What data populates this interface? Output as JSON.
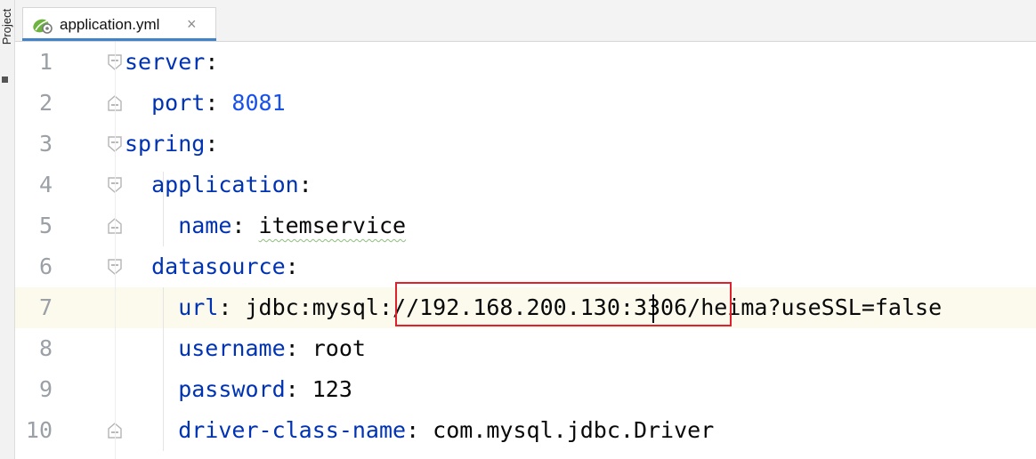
{
  "sidebar": {
    "label": "Project"
  },
  "tab": {
    "title": "application.yml",
    "close": "×"
  },
  "lines": [
    {
      "num": "1",
      "parts": [
        {
          "t": "server",
          "c": "key"
        },
        {
          "t": ":",
          "c": "val"
        }
      ]
    },
    {
      "num": "2",
      "parts": [
        {
          "t": "  port",
          "c": "key"
        },
        {
          "t": ": ",
          "c": "val"
        },
        {
          "t": "8081",
          "c": "num"
        }
      ]
    },
    {
      "num": "3",
      "parts": [
        {
          "t": "spring",
          "c": "key"
        },
        {
          "t": ":",
          "c": "val"
        }
      ]
    },
    {
      "num": "4",
      "parts": [
        {
          "t": "  application",
          "c": "key"
        },
        {
          "t": ":",
          "c": "val"
        }
      ]
    },
    {
      "num": "5",
      "parts": [
        {
          "t": "    name",
          "c": "key"
        },
        {
          "t": ": ",
          "c": "val"
        },
        {
          "t": "itemservice",
          "c": "val wavy"
        }
      ]
    },
    {
      "num": "6",
      "parts": [
        {
          "t": "  datasource",
          "c": "key"
        },
        {
          "t": ":",
          "c": "val"
        }
      ]
    },
    {
      "num": "7",
      "parts": [
        {
          "t": "    url",
          "c": "key"
        },
        {
          "t": ": jdbc:mysql://192.168.200.130:3306/heima?useSSL=false",
          "c": "val"
        }
      ]
    },
    {
      "num": "8",
      "parts": [
        {
          "t": "    username",
          "c": "key"
        },
        {
          "t": ": root",
          "c": "val"
        }
      ]
    },
    {
      "num": "9",
      "parts": [
        {
          "t": "    password",
          "c": "key"
        },
        {
          "t": ": 123",
          "c": "val"
        }
      ]
    },
    {
      "num": "10",
      "parts": [
        {
          "t": "    driver-class-name",
          "c": "key"
        },
        {
          "t": ": com.mysql.jdbc.Driver",
          "c": "val"
        }
      ]
    }
  ],
  "current_line": 7,
  "colors": {
    "key": "#0033b3",
    "number": "#1750eb",
    "text": "#080808",
    "highlight_box": "#e0202a",
    "current_line_bg": "#fcfaed"
  }
}
